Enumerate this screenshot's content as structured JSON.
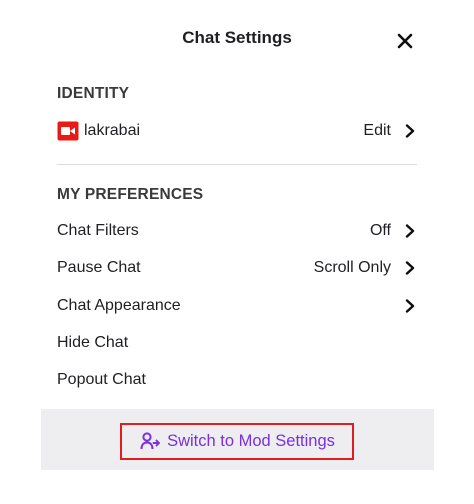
{
  "header": {
    "title": "Chat Settings",
    "close_icon": "close-icon"
  },
  "identity": {
    "heading": "IDENTITY",
    "username": "lakrabai",
    "badge_icon": "video-camera-icon",
    "badge_color": "#e91916",
    "edit_label": "Edit"
  },
  "preferences": {
    "heading": "MY PREFERENCES",
    "items": [
      {
        "label": "Chat Filters",
        "value": "Off",
        "has_chevron": true
      },
      {
        "label": "Pause Chat",
        "value": "Scroll Only",
        "has_chevron": true
      },
      {
        "label": "Chat Appearance",
        "value": "",
        "has_chevron": true
      },
      {
        "label": "Hide Chat",
        "value": "",
        "has_chevron": false
      },
      {
        "label": "Popout Chat",
        "value": "",
        "has_chevron": false
      }
    ]
  },
  "footer": {
    "mod_settings_label": "Switch to Mod Settings",
    "mod_icon": "user-switch-icon",
    "accent_color": "#7a2fe0",
    "highlight_color": "#e01b24"
  }
}
